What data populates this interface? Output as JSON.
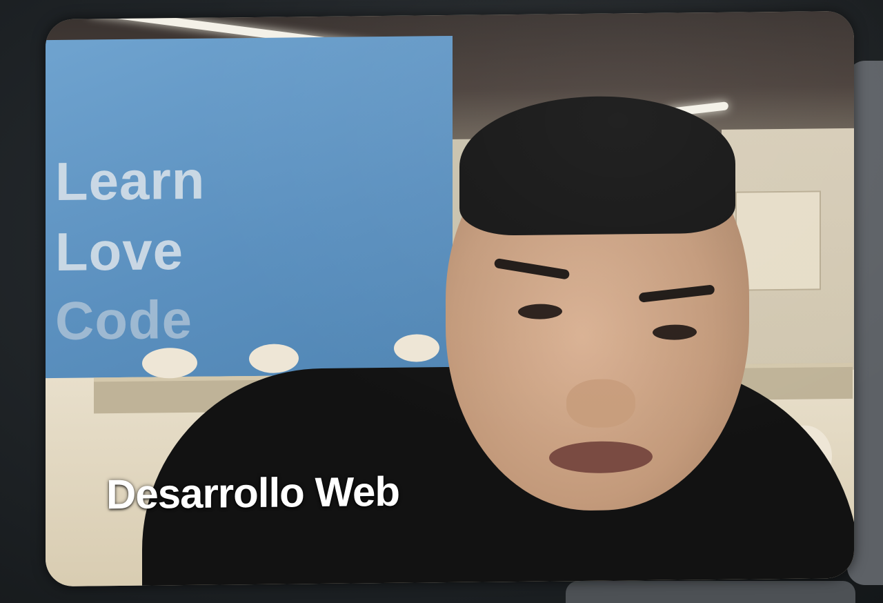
{
  "video_tile": {
    "participant_name": "Desarrollo Web",
    "background_wall_text": [
      "Learn",
      "Love",
      "Code"
    ]
  },
  "colors": {
    "wall_blue": "#5b90bf",
    "name_label": "#ffffff",
    "app_background": "#1f2326"
  }
}
